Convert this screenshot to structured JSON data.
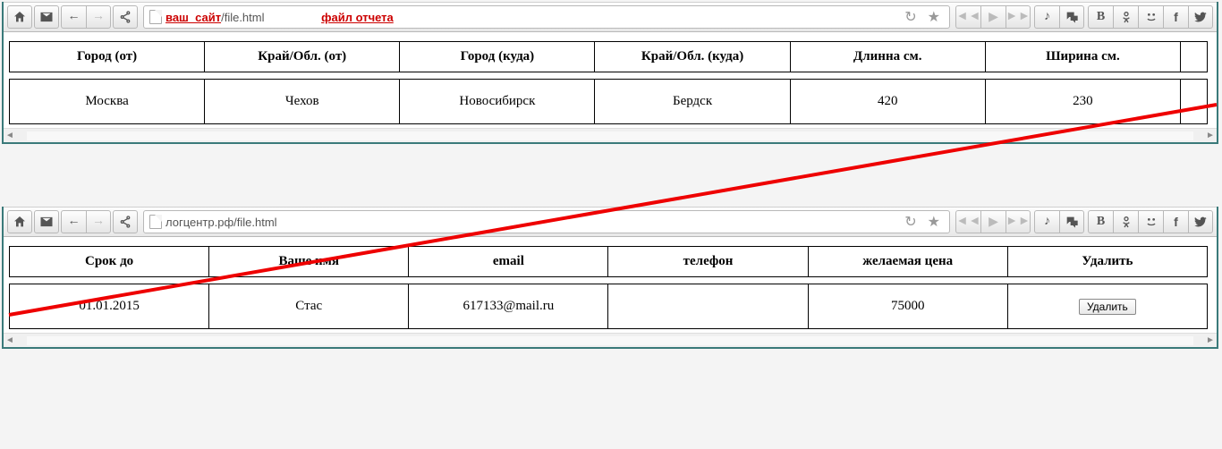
{
  "top": {
    "address_site": "ваш_сайт",
    "address_path": "/file.html",
    "address_annotation": "файл отчета",
    "table": {
      "headers": [
        "Город (от)",
        "Край/Обл. (от)",
        "Город (куда)",
        "Край/Обл. (куда)",
        "Длинна см.",
        "Ширина см."
      ],
      "row": [
        "Москва",
        "Чехов",
        "Новосибирск",
        "Бердск",
        "420",
        "230"
      ]
    }
  },
  "bottom": {
    "address": "логцентр.рф/file.html",
    "table": {
      "headers": [
        "Срок до",
        "Ваше имя",
        "email",
        "телефон",
        "желаемая цена",
        "Удалить"
      ],
      "row": {
        "deadline": "01.01.2015",
        "name": "Стас",
        "email": "617133@mail.ru",
        "phone": "",
        "price": "75000",
        "delete_label": "Удалить"
      }
    }
  }
}
